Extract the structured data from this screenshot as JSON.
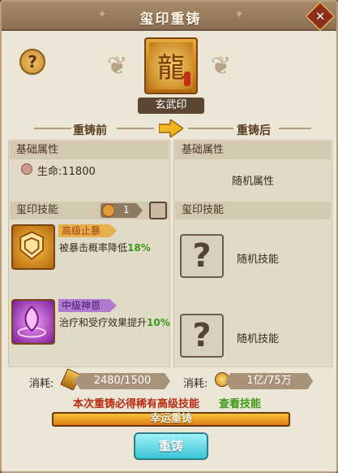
{
  "title": "玺印重铸",
  "help_label": "?",
  "close_label": "✕",
  "seal_name": "玄武印",
  "stages": {
    "before": "重铸前",
    "after": "重铸后"
  },
  "left": {
    "attr_title": "基础属性",
    "attr_line": "生命:11800",
    "skill_title": "玺印技能",
    "lock_count": "1",
    "skills": [
      {
        "name": "高级止暴",
        "desc": "被暴击概率降低",
        "value": "18%"
      },
      {
        "name": "中级神恩",
        "desc": "治疗和受疗效果提升",
        "value": "10%"
      }
    ]
  },
  "right": {
    "attr_title": "基础属性",
    "attr_random": "随机属性",
    "skill_title": "玺印技能",
    "random_skill_1": "随机技能",
    "random_skill_2": "随机技能",
    "unknown_mark": "?"
  },
  "cost": {
    "label_left": "消耗:",
    "left_value": "2480/1500",
    "label_right": "消耗:",
    "right_value": "1亿/75万"
  },
  "notice": {
    "text": "本次重铸必得稀有高级技能",
    "link": "查看技能"
  },
  "buttons": {
    "lucky": "幸运重铸",
    "recast": "重铸"
  },
  "colors": {
    "accent_green": "#3c9a16",
    "title_bar": "#8c6f52",
    "recast_button": "#3cc5d8",
    "lucky_bar": "#dd7c12"
  }
}
